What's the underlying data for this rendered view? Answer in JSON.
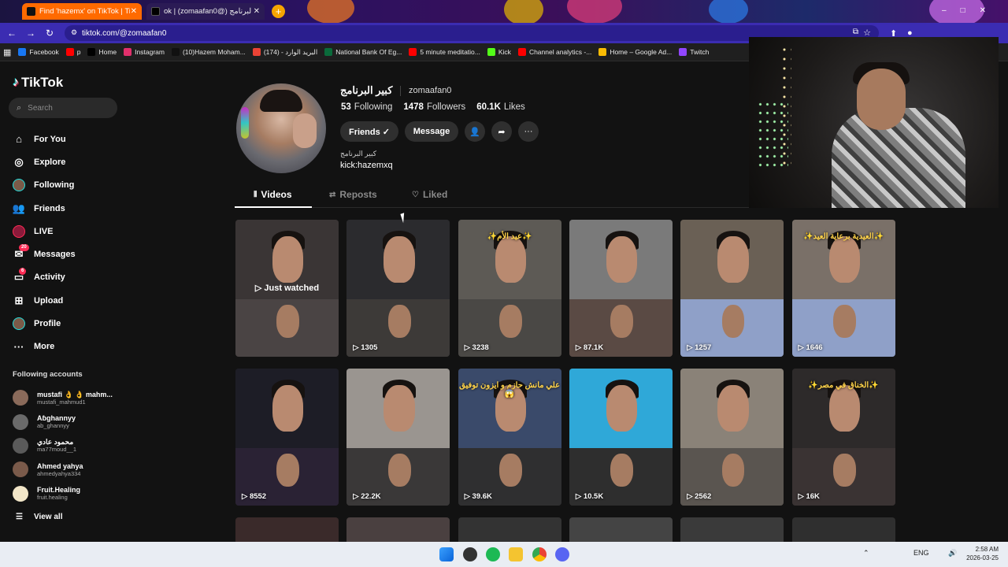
{
  "browser": {
    "tabs": [
      {
        "label": "Find 'hazemx' on TikTok | TikTok",
        "active": true
      },
      {
        "label": "ok | (zomaafan0@) كبير البرنامج",
        "active": false
      }
    ],
    "url": "tiktok.com/@zomaafan0",
    "new_tab": "+",
    "bookmarks": [
      {
        "label": "Facebook",
        "color": "#1877f2"
      },
      {
        "label": "p",
        "color": "#ff0000"
      },
      {
        "label": "Home",
        "color": "#000000"
      },
      {
        "label": "Instagram",
        "color": "#e1306c"
      },
      {
        "label": "(10)Hazem Moham...",
        "color": "#111111"
      },
      {
        "label": "(174) - البريد الوارد",
        "color": "#ea4335"
      },
      {
        "label": "National Bank Of Eg...",
        "color": "#0a6b3b"
      },
      {
        "label": "5 minute meditatio...",
        "color": "#ff0000"
      },
      {
        "label": "Kick",
        "color": "#53fc18"
      },
      {
        "label": "Channel analytics -...",
        "color": "#ff0000"
      },
      {
        "label": "Home – Google Ad...",
        "color": "#fbbc04"
      },
      {
        "label": "Twitch",
        "color": "#9146ff"
      }
    ]
  },
  "sidebar": {
    "logo": "TikTok",
    "search_placeholder": "Search",
    "nav": [
      {
        "label": "For You",
        "icon": "home-icon"
      },
      {
        "label": "Explore",
        "icon": "compass-icon"
      },
      {
        "label": "Following",
        "icon": "following-avatar-icon"
      },
      {
        "label": "Friends",
        "icon": "friends-icon"
      },
      {
        "label": "LIVE",
        "icon": "live-icon"
      },
      {
        "label": "Messages",
        "icon": "messages-icon",
        "badge": "20"
      },
      {
        "label": "Activity",
        "icon": "activity-icon",
        "badge": "6"
      },
      {
        "label": "Upload",
        "icon": "upload-icon"
      },
      {
        "label": "Profile",
        "icon": "profile-avatar-icon"
      },
      {
        "label": "More",
        "icon": "more-icon"
      }
    ],
    "following_title": "Following accounts",
    "following": [
      {
        "name": "mustafi 👌 👌 mahm...",
        "user": "mustafi_mahmud1",
        "color": "#8a6a5a"
      },
      {
        "name": "Aɓghannyy",
        "user": "ab_ghannyy",
        "color": "#6a6a6a"
      },
      {
        "name": "محمود عادي",
        "user": "ma77moud__1",
        "color": "#5a5a5a"
      },
      {
        "name": "Ahmed yahya",
        "user": "ahmedyahya334",
        "color": "#7a5a4a"
      },
      {
        "name": "Fruit.Healing",
        "user": "fruit.healing",
        "color": "#f2e6c8"
      }
    ],
    "view_all": "View all"
  },
  "profile": {
    "display_name": "كبير البرنامج",
    "username": "zomaafan0",
    "following_count": "53",
    "following_label": "Following",
    "followers_count": "1478",
    "followers_label": "Followers",
    "likes_count": "60.1K",
    "likes_label": "Likes",
    "friends_button": "Friends ✓",
    "message_button": "Message",
    "bio_line1": "كبير البرنامج",
    "bio_line2": "kick:hazemxq"
  },
  "tabs": {
    "videos": "Videos",
    "reposts": "Reposts",
    "liked": "Liked"
  },
  "videos": [
    {
      "views": "",
      "overlay": "Just watched",
      "top": "#3a3535",
      "bot": "#4a4444"
    },
    {
      "views": "1305",
      "overlay": "",
      "top": "#2b2b2e",
      "bot": "#3d3a38"
    },
    {
      "views": "3238",
      "overlay": "✨عيد الأم✨",
      "top": "#5d5a55",
      "bot": "#4a4845"
    },
    {
      "views": "87.1K",
      "overlay": "",
      "top": "#7a7a7a",
      "bot": "#5a4a44"
    },
    {
      "views": "1257",
      "overlay": "",
      "top": "#6a6055",
      "bot": "#8fa0c8"
    },
    {
      "views": "1646",
      "overlay": "✨العيدية برعاية العيد✨",
      "top": "#7a7068",
      "bot": "#8fa0c8"
    },
    {
      "views": "8552",
      "overlay": "",
      "top": "#1d1d26",
      "bot": "#2a2234"
    },
    {
      "views": "22.2K",
      "overlay": "",
      "top": "#9a9590",
      "bot": "#3a3838"
    },
    {
      "views": "39.6K",
      "overlay": "علي مانش حازم و ايزون توفيق 😱",
      "top": "#3a4a6a",
      "bot": "#2f2f30"
    },
    {
      "views": "10.5K",
      "overlay": "",
      "top": "#2fa8d8",
      "bot": "#2e2e2e"
    },
    {
      "views": "2562",
      "overlay": "",
      "top": "#8a8278",
      "bot": "#5a5550"
    },
    {
      "views": "16K",
      "overlay": "✨الخناق في مصر✨",
      "top": "#2d2a2a",
      "bot": "#3a3333"
    }
  ],
  "webcam_label": "webcam-overlay",
  "taskbar": {
    "lang": "ENG",
    "time": "2:58 AM",
    "date": "2026-03-25"
  }
}
